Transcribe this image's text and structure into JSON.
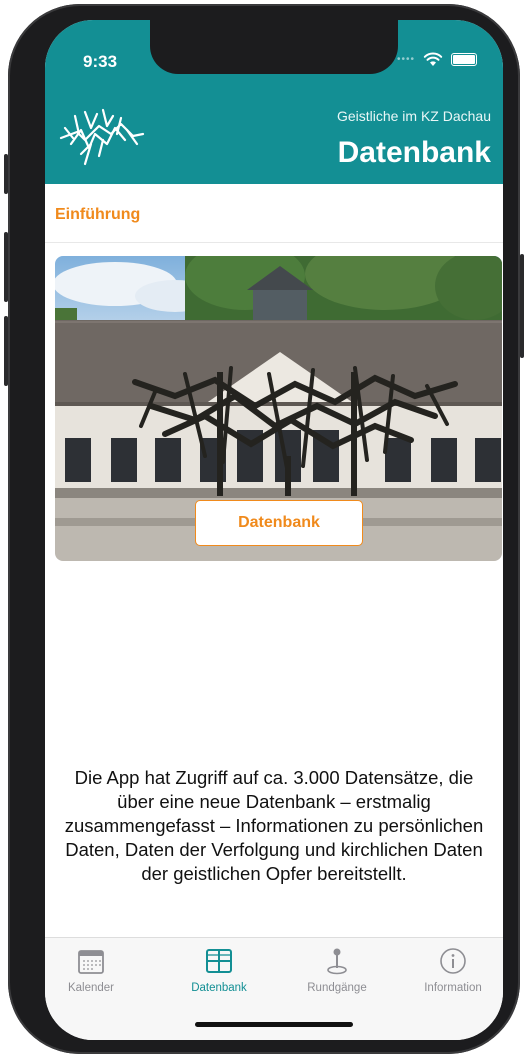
{
  "status_bar": {
    "time": "9:33"
  },
  "header": {
    "subtitle": "Geistliche im KZ Dachau",
    "title": "Datenbank",
    "logo_icon": "memorial-sculpture-logo-icon"
  },
  "section": {
    "label": "Einführung"
  },
  "hero": {
    "button_label": "Datenbank"
  },
  "description": "Die App hat Zugriff auf ca. 3.000 Datensätze, die über eine neue Datenbank – erstmalig zusammengefasst – Informationen zu persönlichen Daten, Daten der Verfolgung und kirchlichen Daten der geistlichen Opfer bereitstellt.",
  "tabbar": {
    "items": [
      {
        "label": "Kalender",
        "icon": "calendar-icon",
        "active": false
      },
      {
        "label": "Datenbank",
        "icon": "table-icon",
        "active": true
      },
      {
        "label": "Rundgänge",
        "icon": "map-pin-icon",
        "active": false
      },
      {
        "label": "Information",
        "icon": "info-icon",
        "active": false
      }
    ]
  },
  "colors": {
    "teal": "#138f94",
    "orange": "#f08a1c",
    "inactive": "#8e8e93"
  }
}
